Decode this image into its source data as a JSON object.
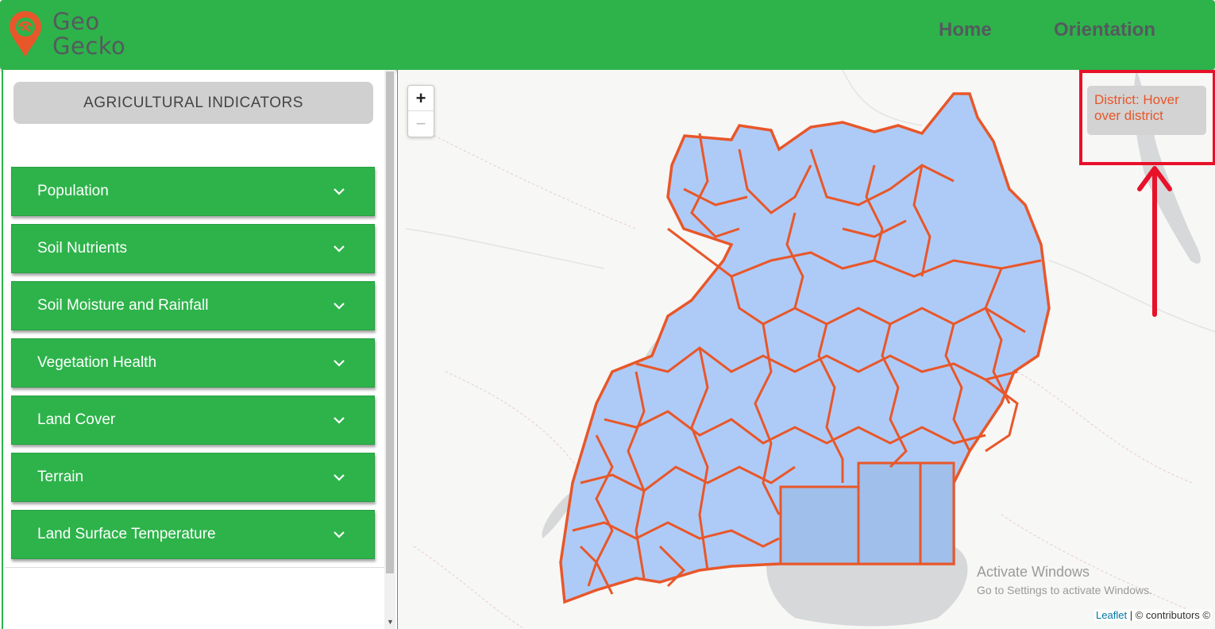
{
  "app": {
    "brand_line1": "Geo",
    "brand_line2": "Gecko",
    "nav": [
      {
        "label": "Home"
      },
      {
        "label": "Orientation"
      }
    ]
  },
  "sidebar": {
    "header_button": "AGRICULTURAL INDICATORS",
    "sections": [
      {
        "label": "Population",
        "icon": "chevron-down-icon"
      },
      {
        "label": "Soil Nutrients",
        "icon": "chevron-down-icon"
      },
      {
        "label": "Soil Moisture and Rainfall",
        "icon": "chevron-down-icon"
      },
      {
        "label": "Vegetation Health",
        "icon": "chevron-down-icon"
      },
      {
        "label": "Land Cover",
        "icon": "chevron-down-icon"
      },
      {
        "label": "Terrain",
        "icon": "chevron-down-icon"
      },
      {
        "label": "Land Surface Temperature",
        "icon": "chevron-down-icon"
      }
    ]
  },
  "map": {
    "zoom_in": "+",
    "zoom_out": "−",
    "info_panel": "District: Hover over district",
    "attribution_link": "Leaflet",
    "attribution_rest": " | © contributors ©",
    "watermark_line1": "Activate Windows",
    "watermark_line2": "Go to Settings to activate Windows.",
    "colors": {
      "district_fill": "#aecbf7",
      "district_stroke": "#e8572a",
      "lake": "#d7d8d9",
      "annotation": "#e8112a"
    }
  },
  "colors": {
    "brand_green": "#2db34a",
    "nav_text": "#555a5e"
  }
}
